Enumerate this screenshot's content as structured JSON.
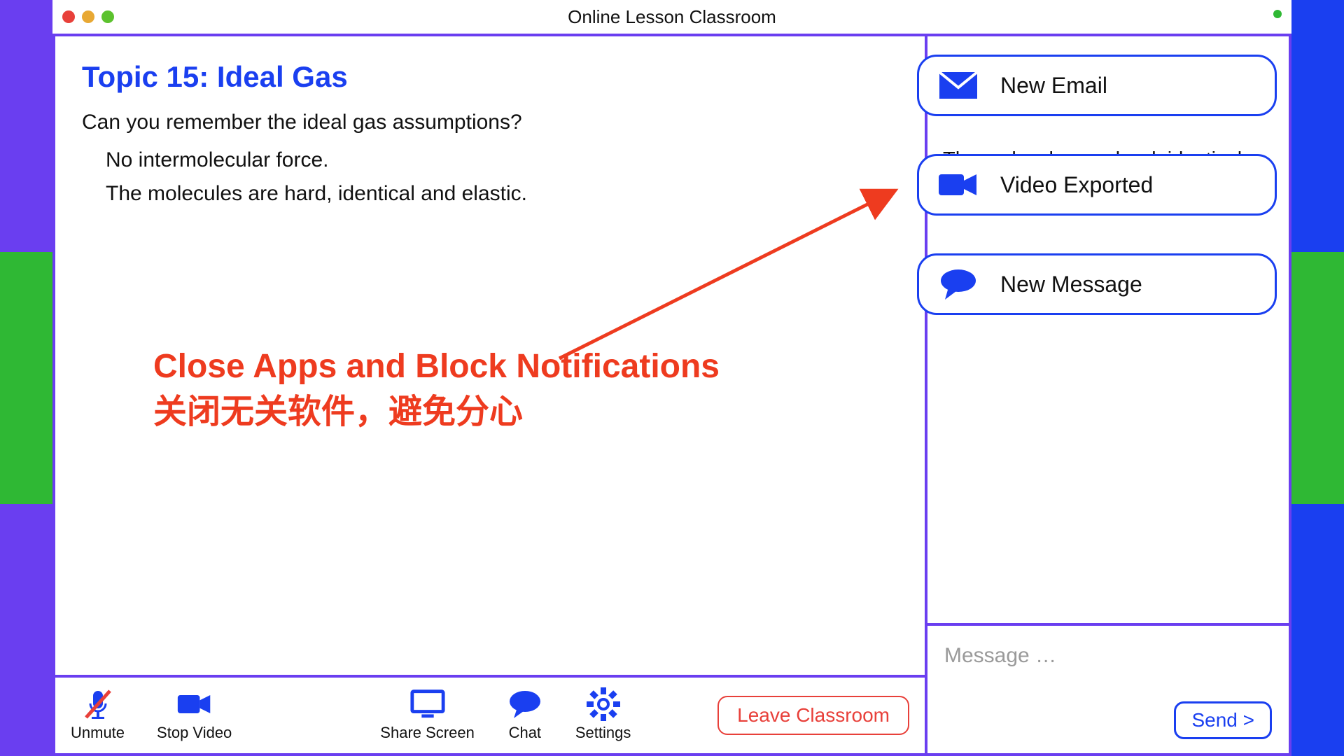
{
  "window": {
    "title": "Online Lesson Classroom"
  },
  "content": {
    "topic_title": "Topic 15: Ideal Gas",
    "prompt": "Can you remember the ideal gas assumptions?",
    "bullets": [
      "No intermolecular force.",
      "The molecules are hard, identical and elastic."
    ]
  },
  "annotation": {
    "line1": "Close Apps and Block Notifications",
    "line2": "关闭无关软件，避免分心"
  },
  "toolbar": {
    "unmute": "Unmute",
    "stop_video": "Stop Video",
    "share_screen": "Share Screen",
    "chat": "Chat",
    "settings": "Settings",
    "leave": "Leave Classroom"
  },
  "side": {
    "peek_text": "The molecules are hard, identical",
    "message_placeholder": "Message …",
    "send_label": "Send >"
  },
  "notifications": [
    {
      "icon": "mail",
      "label": "New Email"
    },
    {
      "icon": "video",
      "label": "Video Exported"
    },
    {
      "icon": "chat",
      "label": "New Message"
    }
  ],
  "colors": {
    "accent_blue": "#1a3ff0",
    "accent_purple": "#6a3ef0",
    "accent_green": "#2fb834",
    "accent_red": "#ee3b1f"
  }
}
